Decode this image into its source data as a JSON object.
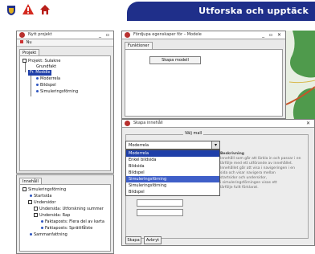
{
  "app": {
    "title": "Utforska och upptäck",
    "brand_color": "#1f2f8a",
    "toolbar_icons": [
      "crest-icon",
      "warning-triangle-icon",
      "house-icon"
    ]
  },
  "project_window": {
    "title": "Nytt projekt",
    "menu_label": "Nu",
    "tab_label": "Projekt",
    "tree": [
      {
        "label": "Projekt: Sulakne",
        "level": 0
      },
      {
        "label": "Grundfakt",
        "level": 1
      },
      {
        "label": "Fr. Moddle",
        "level": 1,
        "selected": true
      },
      {
        "label": "Moderrela",
        "level": 2
      },
      {
        "label": "Bildspel",
        "level": 2
      },
      {
        "label": "Simuleringsförning",
        "level": 2
      }
    ]
  },
  "activity_window": {
    "tab_label": "Innehåll",
    "tree": [
      {
        "label": "Simuleringsförning",
        "level": 0
      },
      {
        "label": "Startsida",
        "level": 1
      },
      {
        "label": "Undersidor",
        "level": 1
      },
      {
        "label": "Undersida: Utforskning summer",
        "level": 2
      },
      {
        "label": "Undersida: Rap",
        "level": 2
      },
      {
        "label": "Faktaposts: Flera del av karta",
        "level": 3
      },
      {
        "label": "Faktaposts: Sprättfålste",
        "level": 3
      },
      {
        "label": "Sammanfattning",
        "level": 1
      }
    ]
  },
  "module_window": {
    "title": "Fördjupa egenskaper för – Modele",
    "tab_label": "Funktioner",
    "create_button": "Skapa modell"
  },
  "dialog": {
    "title": "Skapa innehåll",
    "group_label": "Välj mall",
    "selected_value": "Moderrela",
    "options": [
      {
        "label": "Moderrela",
        "state": "hl"
      },
      {
        "label": "Enkel bildsida",
        "state": ""
      },
      {
        "label": "Bildsida",
        "state": ""
      },
      {
        "label": "Bildspel",
        "state": ""
      },
      {
        "label": "Simuleringsförning",
        "state": "hl2"
      },
      {
        "label": "Simuleringsförning",
        "state": ""
      },
      {
        "label": "Bildspel",
        "state": ""
      }
    ],
    "info_heading": "Beskrivning",
    "info_lines": [
      "Innehåll som går att lärkla in och passar i en",
      "lärfölje med ett utförande av innehållet.",
      "Innehållet går att visa i navigeringen i en",
      "sida och visar navigera mellan",
      "startsidor och undersidor,",
      "i simuleringsförningen visas ett",
      "lärfölje fullt förklarat."
    ],
    "ok_button": "Skapa",
    "cancel_button": "Avbryt"
  }
}
